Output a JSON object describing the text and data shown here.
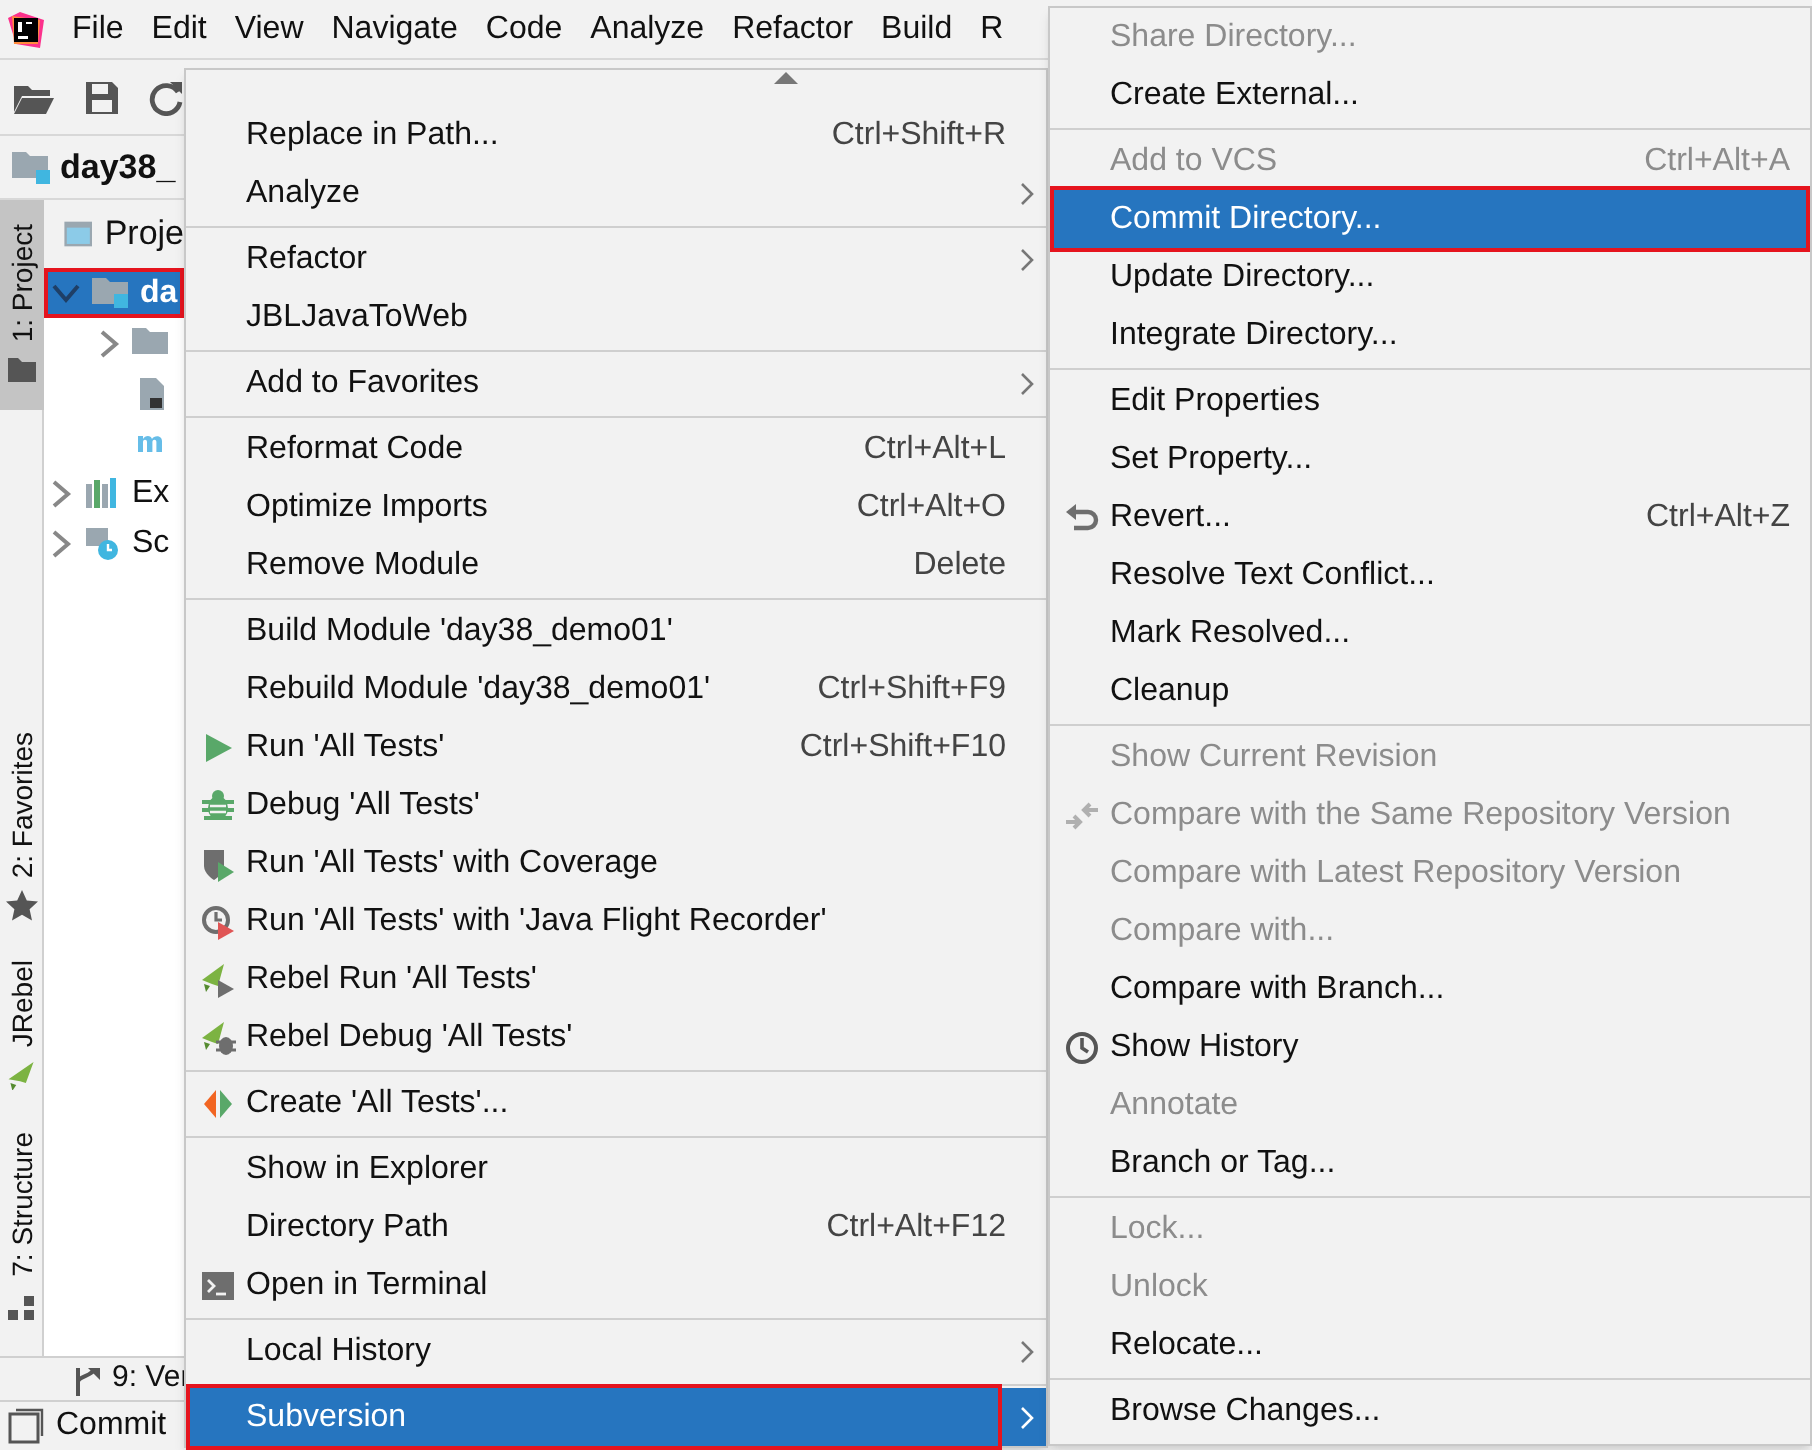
{
  "menubar": {
    "items": [
      "File",
      "Edit",
      "View",
      "Navigate",
      "Code",
      "Analyze",
      "Refactor",
      "Build",
      "R"
    ]
  },
  "breadcrumb": "day38_",
  "tool_window_tabs": [
    {
      "label": "1: Project",
      "kind": "project",
      "selected": true
    },
    {
      "label": "2: Favorites",
      "kind": "favorites",
      "selected": false
    },
    {
      "label": "JRebel",
      "kind": "jrebel",
      "selected": false
    },
    {
      "label": "7: Structure",
      "kind": "structure",
      "selected": false
    }
  ],
  "project_panel": {
    "title": "Proje",
    "tree": [
      {
        "label": "da",
        "kind": "module",
        "selected": true,
        "outlined": true,
        "expanded": true,
        "children": [
          {
            "kind": "folder",
            "expanded": false
          },
          {
            "kind": "file"
          },
          {
            "kind": "maven"
          }
        ]
      },
      {
        "label": "Ex",
        "kind": "libraries",
        "selected": false,
        "expanded": false
      },
      {
        "label": "Sc",
        "kind": "scratches",
        "selected": false,
        "expanded": false
      }
    ]
  },
  "bottom_tabs": [
    {
      "label": "9: Ver",
      "kind": "vcs"
    },
    {
      "label": "Commit",
      "kind": "commit"
    }
  ],
  "context_menu": {
    "groups": [
      [
        {
          "label": "Replace in Path...",
          "shortcut": "Ctrl+Shift+R",
          "selected": false
        },
        {
          "label": "Analyze",
          "submenu": true,
          "selected": false
        }
      ],
      [
        {
          "label": "Refactor",
          "submenu": true,
          "selected": false
        },
        {
          "label": "JBLJavaToWeb",
          "selected": false
        }
      ],
      [
        {
          "label": "Add to Favorites",
          "submenu": true,
          "selected": false
        }
      ],
      [
        {
          "label": "Reformat Code",
          "shortcut": "Ctrl+Alt+L",
          "selected": false
        },
        {
          "label": "Optimize Imports",
          "shortcut": "Ctrl+Alt+O",
          "selected": false
        },
        {
          "label": "Remove Module",
          "shortcut": "Delete",
          "selected": false
        }
      ],
      [
        {
          "label": "Build Module 'day38_demo01'",
          "selected": false
        },
        {
          "label": "Rebuild Module 'day38_demo01'",
          "shortcut": "Ctrl+Shift+F9",
          "selected": false
        },
        {
          "label": "Run 'All Tests'",
          "kind": "run",
          "shortcut": "Ctrl+Shift+F10",
          "selected": false
        },
        {
          "label": "Debug 'All Tests'",
          "kind": "debug",
          "selected": false
        },
        {
          "label": "Run 'All Tests' with Coverage",
          "kind": "coverage",
          "selected": false
        },
        {
          "label": "Run 'All Tests' with 'Java Flight Recorder'",
          "kind": "profiler",
          "selected": false
        },
        {
          "label": "Rebel Run 'All Tests'",
          "kind": "rebel-run",
          "selected": false
        },
        {
          "label": "Rebel Debug 'All Tests'",
          "kind": "rebel-debug",
          "selected": false
        }
      ],
      [
        {
          "label": "Create 'All Tests'...",
          "kind": "create",
          "selected": false
        }
      ],
      [
        {
          "label": "Show in Explorer",
          "selected": false
        },
        {
          "label": "Directory Path",
          "shortcut": "Ctrl+Alt+F12",
          "selected": false
        },
        {
          "label": "Open in Terminal",
          "kind": "terminal",
          "selected": false
        }
      ],
      [
        {
          "label": "Local History",
          "submenu": true,
          "selected": false
        }
      ],
      [
        {
          "label": "Subversion",
          "submenu": true,
          "selected": true,
          "outlined": true
        }
      ]
    ]
  },
  "subversion_menu": {
    "groups": [
      [
        {
          "label": "Share Directory...",
          "disabled": true,
          "selected": false
        },
        {
          "label": "Create External...",
          "disabled": false,
          "selected": false
        }
      ],
      [
        {
          "label": "Add to VCS",
          "shortcut": "Ctrl+Alt+A",
          "disabled": true,
          "selected": false
        },
        {
          "label": "Commit Directory...",
          "disabled": false,
          "selected": true,
          "outlined": true
        },
        {
          "label": "Update Directory...",
          "disabled": false,
          "selected": false
        },
        {
          "label": "Integrate Directory...",
          "disabled": false,
          "selected": false
        }
      ],
      [
        {
          "label": "Edit Properties",
          "disabled": false,
          "selected": false
        },
        {
          "label": "Set Property...",
          "disabled": false,
          "selected": false
        },
        {
          "label": "Revert...",
          "kind": "revert",
          "shortcut": "Ctrl+Alt+Z",
          "disabled": false,
          "selected": false
        },
        {
          "label": "Resolve Text Conflict...",
          "disabled": false,
          "selected": false
        },
        {
          "label": "Mark Resolved...",
          "disabled": false,
          "selected": false
        },
        {
          "label": "Cleanup",
          "disabled": false,
          "selected": false
        }
      ],
      [
        {
          "label": "Show Current Revision",
          "disabled": true,
          "selected": false
        },
        {
          "label": "Compare with the Same Repository Version",
          "kind": "compare",
          "disabled": true,
          "selected": false
        },
        {
          "label": "Compare with Latest Repository Version",
          "disabled": true,
          "selected": false
        },
        {
          "label": "Compare with...",
          "disabled": true,
          "selected": false
        },
        {
          "label": "Compare with Branch...",
          "disabled": false,
          "selected": false
        },
        {
          "label": "Show History",
          "kind": "history",
          "disabled": false,
          "selected": false
        },
        {
          "label": "Annotate",
          "disabled": true,
          "selected": false
        },
        {
          "label": "Branch or Tag...",
          "disabled": false,
          "selected": false
        }
      ],
      [
        {
          "label": "Lock...",
          "disabled": true,
          "selected": false
        },
        {
          "label": "Unlock",
          "disabled": true,
          "selected": false
        },
        {
          "label": "Relocate...",
          "disabled": false,
          "selected": false
        }
      ],
      [
        {
          "label": "Browse Changes...",
          "disabled": false,
          "selected": false
        }
      ]
    ]
  }
}
